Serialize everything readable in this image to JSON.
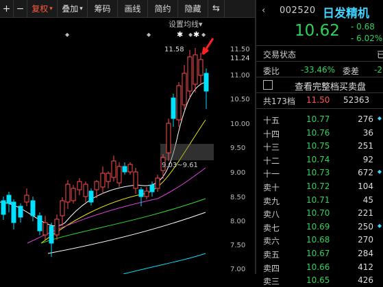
{
  "toolbar": {
    "plus": "+",
    "minus": "−",
    "fuquan": "复权",
    "diejia": "叠加",
    "chouma": "筹码",
    "huaxian": "画线",
    "jianyue": "简约",
    "yincang": "隐藏",
    "expand": "⇆"
  },
  "chart": {
    "settings_label": "设置均线",
    "high_label": "11.58",
    "range_label": "9.03~9.61",
    "price_axis": [
      "11.50",
      "11.24",
      "11.00",
      "10.50",
      "10.00",
      "9.50",
      "9.00",
      "8.50",
      "8.00",
      "7.50",
      "7.00"
    ],
    "colors": {
      "up": "#ff4d4d",
      "down": "#00e0ff",
      "ma5": "#ffffff",
      "ma10": "#e8e800",
      "ma20": "#e040e0",
      "ma60": "#30e030",
      "arrow": "#ff2020"
    }
  },
  "quote": {
    "code": "002520",
    "name": "日发精机",
    "price": "10.62",
    "change": "- 0.68",
    "pct": "- 6.02%",
    "status_label": "交易状态",
    "status_value": "已",
    "weibi_label": "委比",
    "weibi_value": "-33.46%",
    "weicha_label": "委差",
    "weicha_value": "-2",
    "view_label": "查看完整档买卖盘",
    "total_label": "共173档",
    "total_price": "11.50",
    "total_vol": "52363",
    "orders": [
      {
        "label": "十五",
        "price": "10.77",
        "vol": "276",
        "marker": true
      },
      {
        "label": "十四",
        "price": "10.76",
        "vol": "36",
        "marker": false
      },
      {
        "label": "十三",
        "price": "10.75",
        "vol": "251",
        "marker": false
      },
      {
        "label": "十二",
        "price": "10.74",
        "vol": "92",
        "marker": false
      },
      {
        "label": "十一",
        "price": "10.73",
        "vol": "672",
        "marker": true
      },
      {
        "label": "卖十",
        "price": "10.72",
        "vol": "104",
        "marker": false
      },
      {
        "label": "卖九",
        "price": "10.71",
        "vol": "45",
        "marker": false
      },
      {
        "label": "卖八",
        "price": "10.70",
        "vol": "221",
        "marker": false
      },
      {
        "label": "卖七",
        "price": "10.69",
        "vol": "250",
        "marker": true
      },
      {
        "label": "卖六",
        "price": "10.68",
        "vol": "270",
        "marker": false
      },
      {
        "label": "卖五",
        "price": "10.67",
        "vol": "284",
        "marker": false
      },
      {
        "label": "卖四",
        "price": "10.66",
        "vol": "412",
        "marker": false
      },
      {
        "label": "卖三",
        "price": "10.65",
        "vol": "426",
        "marker": false
      }
    ]
  }
}
